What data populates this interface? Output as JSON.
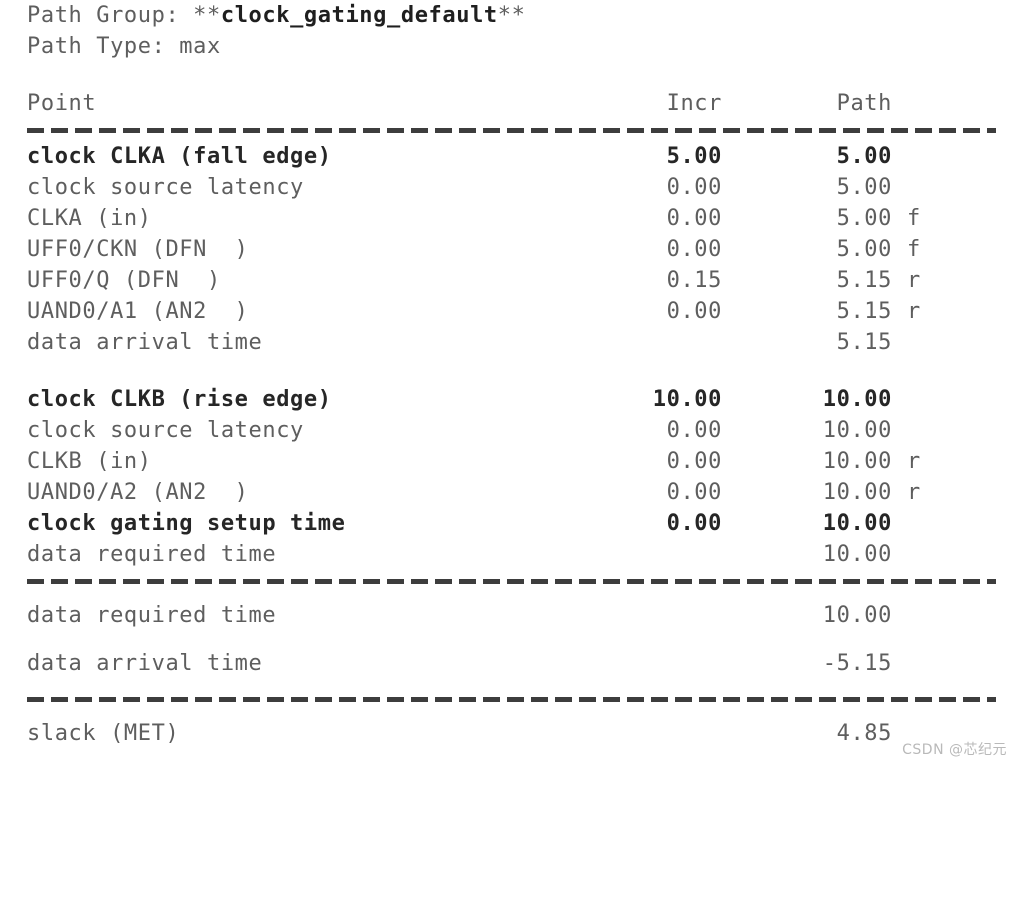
{
  "header": {
    "path_group_label": "Path Group: ",
    "path_group_prefix": "**",
    "path_group_value": "clock_gating_default",
    "path_group_suffix": "**",
    "path_type_line": "Path Type: max"
  },
  "columns": {
    "point": "Point",
    "incr": "Incr",
    "path": "Path"
  },
  "rows": [
    {
      "point": "clock CLKA (fall edge)",
      "incr": "5.00",
      "path": "5.00",
      "edge": "",
      "bold": true
    },
    {
      "point": "clock source latency",
      "incr": "0.00",
      "path": "5.00",
      "edge": "",
      "bold": false
    },
    {
      "point": "CLKA (in)",
      "incr": "0.00",
      "path": "5.00",
      "edge": "f",
      "bold": false
    },
    {
      "point": "UFF0/CKN (DFN  )",
      "incr": "0.00",
      "path": "5.00",
      "edge": "f",
      "bold": false
    },
    {
      "point": "UFF0/Q (DFN  )",
      "incr": "0.15",
      "path": "5.15",
      "edge": "r",
      "bold": false
    },
    {
      "point": "UAND0/A1 (AN2  )",
      "incr": "0.00",
      "path": "5.15",
      "edge": "r",
      "bold": false
    },
    {
      "point": "data arrival time",
      "incr": "",
      "path": "5.15",
      "edge": "",
      "bold": false
    }
  ],
  "rows2": [
    {
      "point": "clock CLKB (rise edge)",
      "incr": "10.00",
      "path": "10.00",
      "edge": "",
      "bold": true
    },
    {
      "point": "clock source latency",
      "incr": "0.00",
      "path": "10.00",
      "edge": "",
      "bold": false
    },
    {
      "point": "CLKB (in)",
      "incr": "0.00",
      "path": "10.00",
      "edge": "r",
      "bold": false
    },
    {
      "point": "UAND0/A2 (AN2  )",
      "incr": "0.00",
      "path": "10.00",
      "edge": "r",
      "bold": false
    },
    {
      "point": "clock gating setup time",
      "incr": "0.00",
      "path": "10.00",
      "edge": "",
      "bold": true
    },
    {
      "point": "data required time",
      "incr": "",
      "path": "10.00",
      "edge": "",
      "bold": false
    }
  ],
  "summary": [
    {
      "point": "data required time",
      "path": "10.00"
    },
    {
      "point": "data arrival time",
      "path": "-5.15"
    }
  ],
  "slack": {
    "point": "slack (MET)",
    "path": "4.85"
  },
  "watermark": "CSDN @芯纪元"
}
